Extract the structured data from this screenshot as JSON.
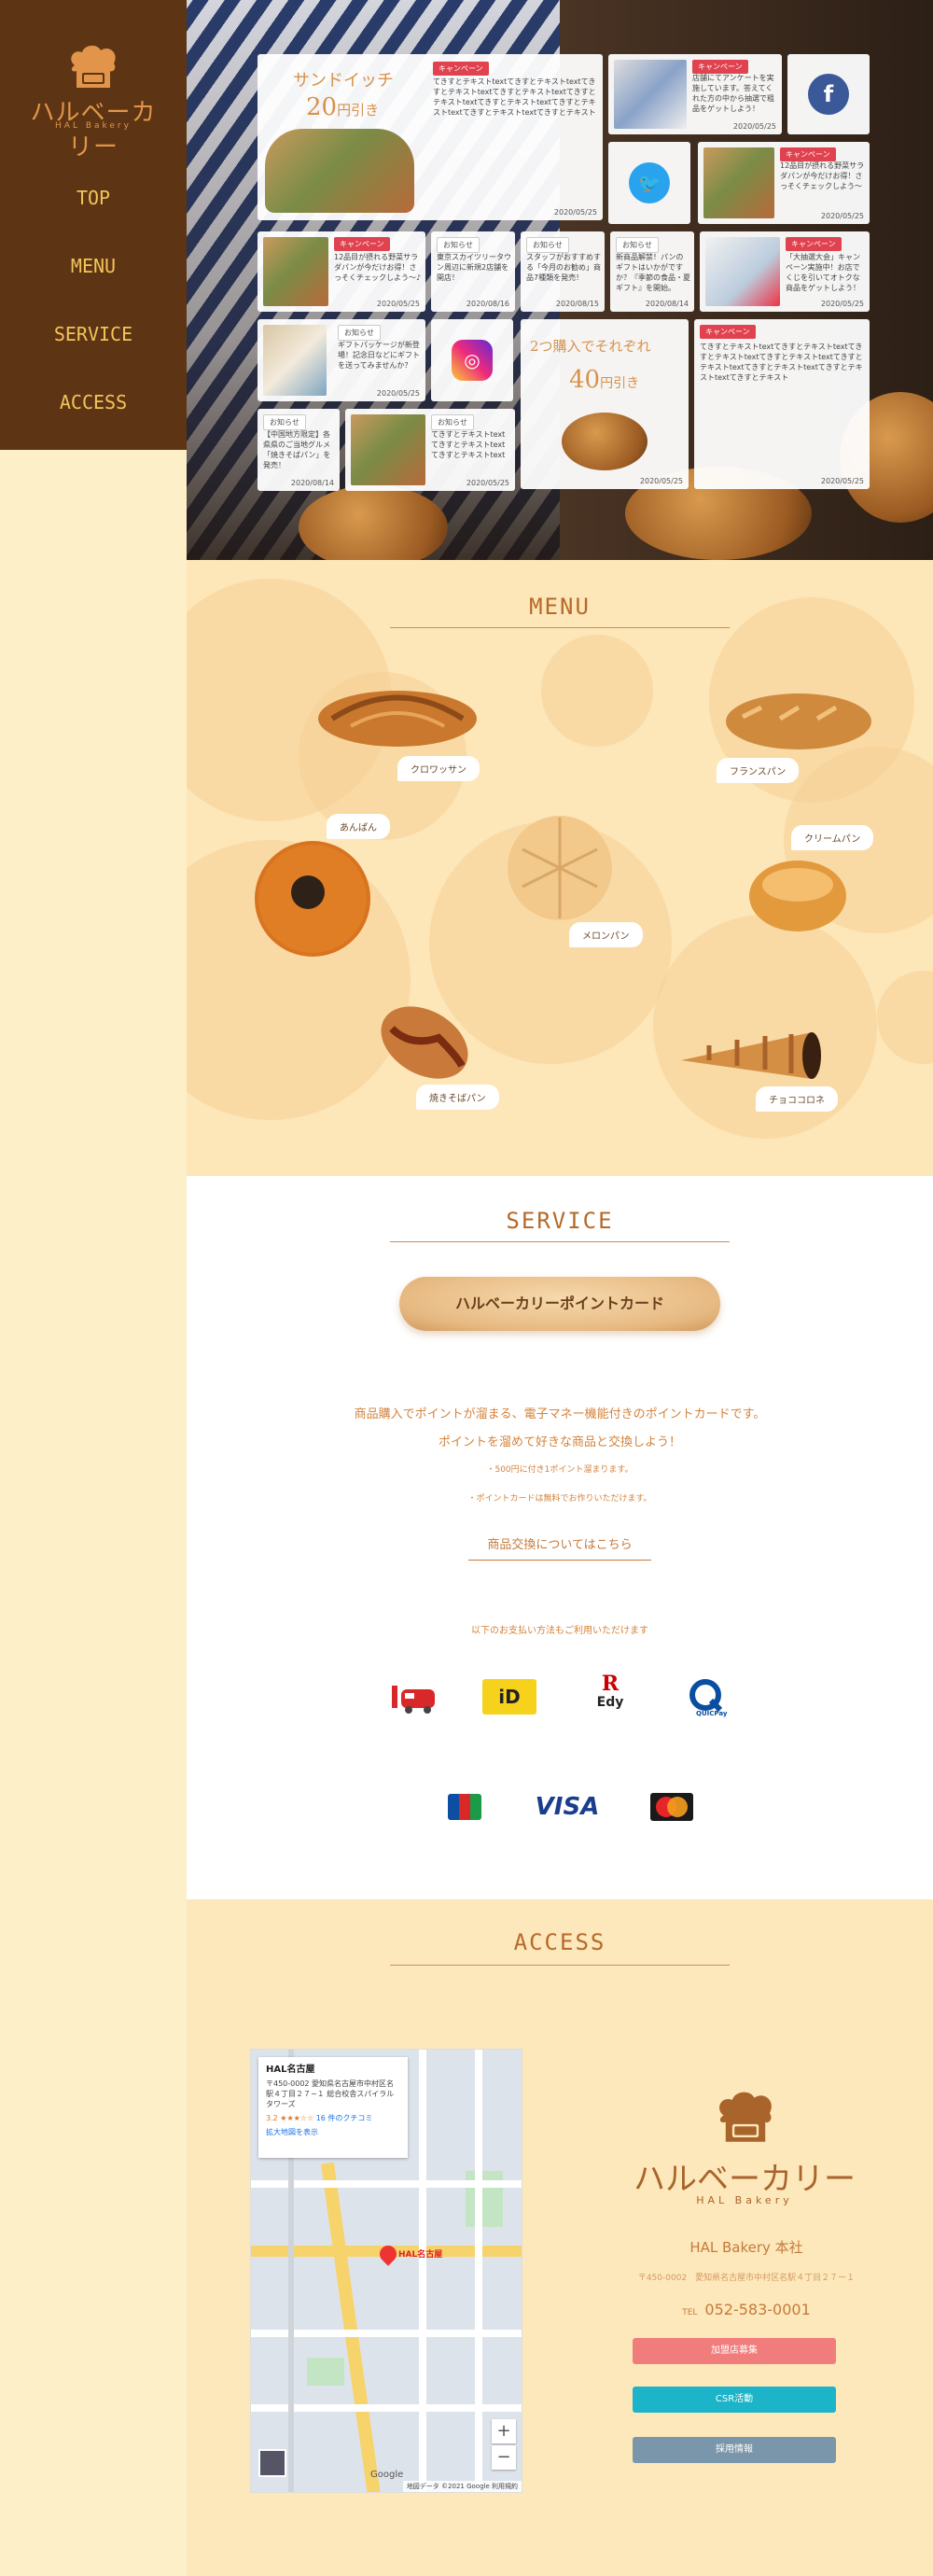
{
  "brand": {
    "name": "ハルベーカリー",
    "sub": "HAL Bakery"
  },
  "nav": [
    "TOP",
    "MENU",
    "SERVICE",
    "ACCESS"
  ],
  "hero": {
    "promo1": {
      "tag": "キャンペーン",
      "title": "サンドイッチ",
      "price": "20",
      "unit": "円引き",
      "text": "てきすとテキストtextてきすとテキストtextてきすとテキストtextてきすとテキストtextてきすとテキストtextてきすとテキストtextてきすとテキストtextてきすとテキストtextてきすとテキスト",
      "date": "2020/05/25"
    },
    "promo2": {
      "tag": "キャンペーン",
      "text": "店舗にてアンケートを実施しています。答えてくれた方の中から抽選で粗品をゲットしよう！",
      "date": "2020/05/25"
    },
    "promo3": {
      "tag": "キャンペーン",
      "text": "12品目が摂れる野菜サラダパンが今だけお得！さっそくチェックしよう～",
      "date": "2020/05/25"
    },
    "row2": [
      {
        "tag": "キャンペーン",
        "text": "12品目が摂れる野菜サラダパンが今だけお得！さっそくチェックしよう～♪",
        "date": "2020/05/25",
        "kind": "campaign"
      },
      {
        "tag": "お知らせ",
        "text": "東京スカイツリータウン周辺に新規2店舗を開店！",
        "date": "2020/08/16",
        "kind": "news"
      },
      {
        "tag": "お知らせ",
        "text": "スタッフがおすすめする「今月のお勧め」商品7種類を発売！",
        "date": "2020/08/15",
        "kind": "news"
      },
      {
        "tag": "お知らせ",
        "text": "新商品解禁！パンのギフトはいかがですか？『季節の食品・夏ギフト』を開始。",
        "date": "2020/08/14",
        "kind": "news"
      },
      {
        "tag": "キャンペーン",
        "text": "「大抽選大会」キャンペーン実施中！お店でくじを引いてオトクな商品をゲットしよう！",
        "date": "2020/05/25",
        "kind": "campaign"
      }
    ],
    "gift": {
      "tag": "お知らせ",
      "text": "ギフトパッケージが新登場！記念日などにギフトを送ってみませんか？",
      "date": "2020/05/25"
    },
    "promo4": {
      "title": "2つ購入でそれぞれ",
      "price": "40",
      "unit": "円引き",
      "date": "2020/05/25"
    },
    "promo5": {
      "tag": "キャンペーン",
      "text": "てきすとテキストtextてきすとテキストtextてきすとテキストtextてきすとテキストtextてきすとテキストtextてきすとテキストtextてきすとテキストtextてきすとテキスト",
      "date": "2020/05/25"
    },
    "news6": {
      "tag": "お知らせ",
      "text": "【中国地方限定】各県県のご当地グルメ「焼きそばパン」を発売！",
      "date": "2020/08/14"
    },
    "news7": {
      "tag": "お知らせ",
      "text": "てきすとテキストtextてきすとテキストtextてきすとテキストtext",
      "date": "2020/05/25"
    }
  },
  "menu": {
    "title": "MENU",
    "items": [
      "クロワッサン",
      "フランスパン",
      "あんぱん",
      "メロンパン",
      "クリームパン",
      "焼きそばパン",
      "チョココロネ"
    ]
  },
  "service": {
    "title": "SERVICE",
    "card": "ハルベーカリーポイントカード",
    "line1": "商品購入でポイントが溜まる、電子マネー機能付きのポイントカードです。",
    "line2": "ポイントを溜めて好きな商品と交換しよう！",
    "note1": "・500円に付き1ポイント溜まります。",
    "note2": "・ポイントカードは無料でお作りいただけます。",
    "exchange": "商品交換についてはこちら",
    "payment_caption": "以下のお支払い方法もご利用いただけます",
    "payments": [
      "iC",
      "iD",
      "R Edy",
      "QUICPay",
      "JCB",
      "VISA",
      "MasterCard"
    ]
  },
  "access": {
    "title": "ACCESS",
    "map": {
      "place": "HAL名古屋",
      "address": "〒450-0002 愛知県名古屋市中村区名駅４丁目２７−１ 総合校舎スパイラルタワーズ",
      "rating": "3.2",
      "reviews": "16 件のクチコミ",
      "enlarge": "拡大地図を表示",
      "credit": "地図データ ©2021 Google",
      "terms": "利用規約",
      "google": "Google",
      "pin_label": "HAL名古屋"
    },
    "company": "HAL Bakery 本社",
    "address": "〒450-0002　愛知県名古屋市中村区名駅４丁目２７ー１",
    "tel_label": "TEL",
    "tel": "052-583-0001",
    "buttons": [
      {
        "label": "加盟店募集",
        "color": "#f07c7c"
      },
      {
        "label": "CSR活動",
        "color": "#1bb4c8"
      },
      {
        "label": "採用情報",
        "color": "#7a96aa"
      }
    ]
  }
}
